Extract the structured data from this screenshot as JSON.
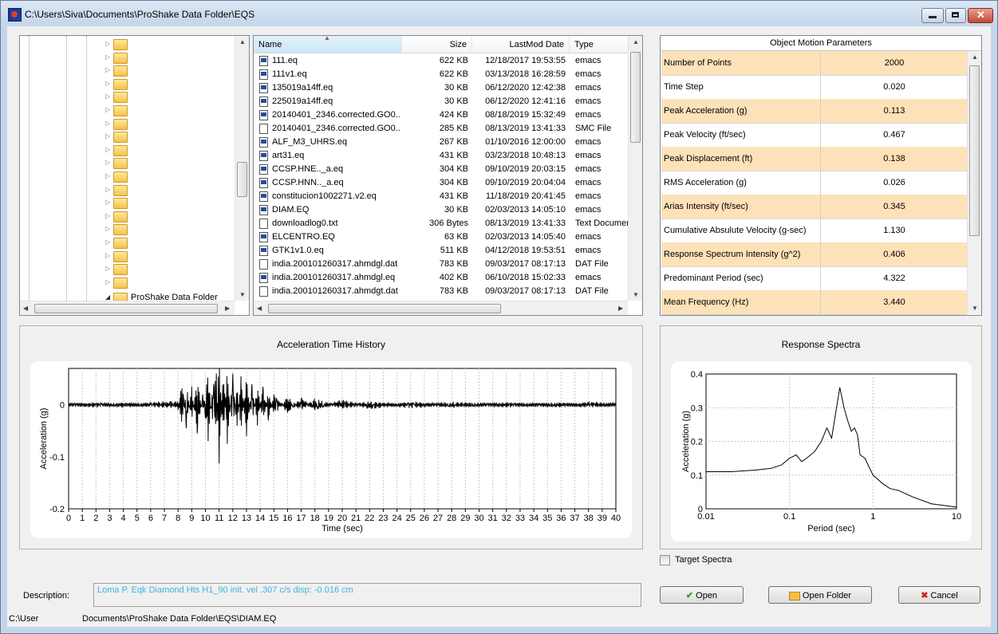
{
  "window": {
    "title": "C:\\Users\\Siva\\Documents\\ProShake Data Folder\\EQS"
  },
  "tree": {
    "last_item": "ProShake Data Folder"
  },
  "files": {
    "columns": {
      "name": "Name",
      "size": "Size",
      "lastmod": "LastMod Date",
      "type": "Type"
    },
    "rows": [
      {
        "name": "111.eq",
        "size": "622 KB",
        "date": "12/18/2017 19:53:55",
        "type": "emacs",
        "icon": "eq-file-icon"
      },
      {
        "name": "111v1.eq",
        "size": "622 KB",
        "date": "03/13/2018 16:28:59",
        "type": "emacs",
        "icon": "eq-file-icon"
      },
      {
        "name": "135019a14ff.eq",
        "size": "30 KB",
        "date": "06/12/2020 12:42:38",
        "type": "emacs",
        "icon": "eq-file-icon"
      },
      {
        "name": "225019a14ff.eq",
        "size": "30 KB",
        "date": "06/12/2020 12:41:16",
        "type": "emacs",
        "icon": "eq-file-icon"
      },
      {
        "name": "20140401_2346.corrected.GO0...",
        "size": "424 KB",
        "date": "08/18/2019 15:32:49",
        "type": "emacs",
        "icon": "eq-file-icon"
      },
      {
        "name": "20140401_2346.corrected.GO0...",
        "size": "285 KB",
        "date": "08/13/2019 13:41:33",
        "type": "SMC File",
        "icon": "blank-file-icon"
      },
      {
        "name": "ALF_M3_UHRS.eq",
        "size": "267 KB",
        "date": "01/10/2016 12:00:00",
        "type": "emacs",
        "icon": "eq-file-icon"
      },
      {
        "name": "art31.eq",
        "size": "431 KB",
        "date": "03/23/2018 10:48:13",
        "type": "emacs",
        "icon": "eq-file-icon"
      },
      {
        "name": "CCSP.HNE.._a.eq",
        "size": "304 KB",
        "date": "09/10/2019 20:03:15",
        "type": "emacs",
        "icon": "eq-file-icon"
      },
      {
        "name": "CCSP.HNN.._a.eq",
        "size": "304 KB",
        "date": "09/10/2019 20:04:04",
        "type": "emacs",
        "icon": "eq-file-icon"
      },
      {
        "name": "constitucion1002271.v2.eq",
        "size": "431 KB",
        "date": "11/18/2019 20:41:45",
        "type": "emacs",
        "icon": "eq-file-icon"
      },
      {
        "name": "DIAM.EQ",
        "size": "30 KB",
        "date": "02/03/2013 14:05:10",
        "type": "emacs",
        "icon": "eq-file-icon"
      },
      {
        "name": "downloadlog0.txt",
        "size": "306 Bytes",
        "date": "08/13/2019 13:41:33",
        "type": "Text Documer",
        "icon": "text-file-icon"
      },
      {
        "name": "ELCENTRO.EQ",
        "size": "63 KB",
        "date": "02/03/2013 14:05:40",
        "type": "emacs",
        "icon": "eq-file-icon"
      },
      {
        "name": "GTK1v1.0.eq",
        "size": "511 KB",
        "date": "04/12/2018 19:53:51",
        "type": "emacs",
        "icon": "eq-file-icon"
      },
      {
        "name": "india.200101260317.ahmdgl.dat",
        "size": "783 KB",
        "date": "09/03/2017 08:17:13",
        "type": "DAT File",
        "icon": "dat-file-icon"
      },
      {
        "name": "india.200101260317.ahmdgl.eq",
        "size": "402 KB",
        "date": "06/10/2018 15:02:33",
        "type": "emacs",
        "icon": "eq-file-icon"
      },
      {
        "name": "india.200101260317.ahmdgt.dat",
        "size": "783 KB",
        "date": "09/03/2017 08:17:13",
        "type": "DAT File",
        "icon": "dat-file-icon"
      }
    ]
  },
  "params": {
    "title": "Object Motion Parameters",
    "rows": [
      {
        "name": "Number of Points",
        "value": "2000"
      },
      {
        "name": "Time Step",
        "value": "0.020"
      },
      {
        "name": "Peak Acceleration (g)",
        "value": "0.113"
      },
      {
        "name": "Peak Velocity (ft/sec)",
        "value": "0.467"
      },
      {
        "name": "Peak Displacement (ft)",
        "value": "0.138"
      },
      {
        "name": "RMS Acceleration (g)",
        "value": "0.026"
      },
      {
        "name": "Arias Intensity (ft/sec)",
        "value": "0.345"
      },
      {
        "name": "Cumulative Absulute Velocity (g-sec)",
        "value": "1.130"
      },
      {
        "name": "Response Spectrum Intensity (g^2)",
        "value": "0.406"
      },
      {
        "name": "Predominant Period (sec)",
        "value": "4.322"
      },
      {
        "name": "Mean Frequency (Hz)",
        "value": "3.440"
      }
    ]
  },
  "chart_data": [
    {
      "type": "line",
      "title": "Acceleration Time History",
      "xlabel": "Time (sec)",
      "ylabel": "Acceleration (g)",
      "xlim": [
        0,
        40
      ],
      "ylim": [
        -0.2,
        0.07
      ],
      "xticks": [
        "0",
        "1",
        "2",
        "3",
        "4",
        "5",
        "6",
        "7",
        "8",
        "9",
        "10",
        "11",
        "12",
        "13",
        "14",
        "15",
        "16",
        "17",
        "18",
        "19",
        "20",
        "21",
        "22",
        "23",
        "24",
        "25",
        "26",
        "27",
        "28",
        "29",
        "30",
        "31",
        "32",
        "33",
        "34",
        "35",
        "36",
        "37",
        "38",
        "39",
        "40"
      ],
      "yticks": [
        "0",
        "-0.1",
        "-0.2"
      ],
      "grid": true,
      "series": [
        {
          "x": [
            0,
            2,
            4,
            6,
            7.5,
            8,
            8.3,
            8.6,
            9,
            9.4,
            9.8,
            10.2,
            10.5,
            10.8,
            11.0,
            11.3,
            11.6,
            12.0,
            12.3,
            12.6,
            13.0,
            13.4,
            13.8,
            14.2,
            14.6,
            15.0,
            16,
            17,
            18,
            20,
            22,
            25,
            28,
            32,
            36,
            38,
            40
          ],
          "y": [
            0,
            0.002,
            -0.002,
            0.002,
            0.005,
            -0.01,
            0.045,
            -0.045,
            0.035,
            -0.055,
            0.02,
            -0.07,
            0.03,
            0.06,
            -0.113,
            0.07,
            -0.075,
            0.06,
            -0.05,
            0.055,
            -0.06,
            0.04,
            -0.04,
            0.035,
            -0.03,
            0.02,
            -0.015,
            0.012,
            -0.01,
            0.008,
            -0.006,
            0.004,
            -0.003,
            0.002,
            -0.002,
            0.003,
            0
          ]
        }
      ]
    },
    {
      "type": "line",
      "title": "Response Spectra",
      "xlabel": "Period (sec)",
      "ylabel": "Acceleration (g)",
      "xscale": "log",
      "xlim": [
        0.01,
        10
      ],
      "ylim": [
        0,
        0.4
      ],
      "xticks": [
        "0.01",
        "0.1",
        "1",
        "10"
      ],
      "yticks": [
        "0",
        "0.1",
        "0.2",
        "0.3",
        "0.4"
      ],
      "grid": true,
      "series": [
        {
          "x": [
            0.01,
            0.02,
            0.04,
            0.06,
            0.08,
            0.1,
            0.12,
            0.14,
            0.16,
            0.2,
            0.24,
            0.28,
            0.32,
            0.36,
            0.4,
            0.45,
            0.5,
            0.55,
            0.6,
            0.65,
            0.7,
            0.8,
            1.0,
            1.3,
            1.6,
            2.0,
            3,
            5,
            10
          ],
          "y": [
            0.11,
            0.11,
            0.115,
            0.12,
            0.13,
            0.15,
            0.16,
            0.14,
            0.15,
            0.17,
            0.2,
            0.24,
            0.21,
            0.29,
            0.36,
            0.3,
            0.26,
            0.23,
            0.24,
            0.22,
            0.16,
            0.15,
            0.1,
            0.075,
            0.06,
            0.055,
            0.035,
            0.015,
            0.005
          ]
        }
      ]
    }
  ],
  "target_spectra_label": "Target Spectra",
  "description": {
    "label": "Description:",
    "value": "Loma P. Eqk Diamond Hts H1_90 init. vel .307 c/s disp: -0.016 cm"
  },
  "buttons": {
    "open": "Open",
    "open_folder": "Open Folder",
    "cancel": "Cancel"
  },
  "status": {
    "left": "C:\\User",
    "path": "Documents\\ProShake Data Folder\\EQS\\DIAM.EQ"
  }
}
